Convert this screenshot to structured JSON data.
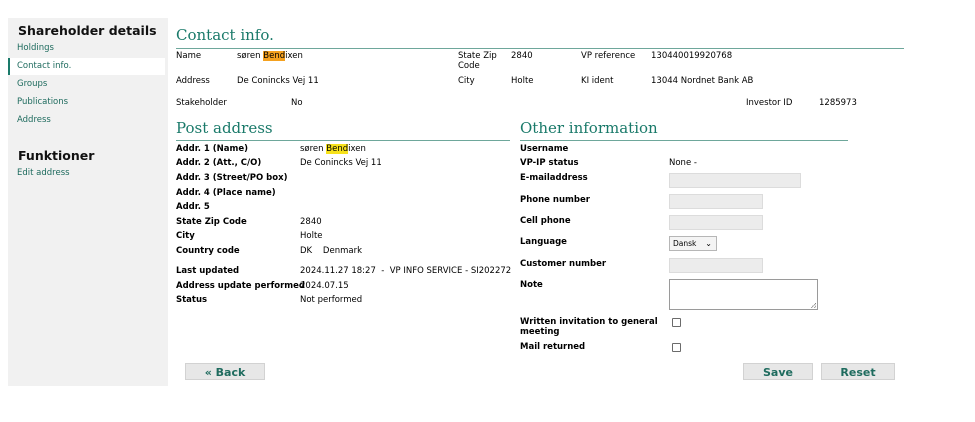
{
  "sidebar": {
    "title": "Shareholder details",
    "items": [
      "Holdings",
      "Contact info.",
      "Groups",
      "Publications",
      "Address"
    ],
    "functions_title": "Funktioner",
    "functions": [
      "Edit address"
    ]
  },
  "contact": {
    "heading": "Contact info.",
    "name_label": "Name",
    "name_prefix": "søren ",
    "name_highlight": "Bend",
    "name_suffix": "ixen",
    "state_zip_label_1": "State Zip",
    "state_zip_label_2": "Code",
    "state_zip_value": "2840",
    "vp_reference_label": "VP reference",
    "vp_reference_value": "130440019920768",
    "address_label": "Address",
    "address_value": "De Conincks Vej 11",
    "city_label": "City",
    "city_value": "Holte",
    "ki_ident_label": "KI ident",
    "ki_ident_value": "13044 Nordnet Bank AB",
    "stakeholder_label": "Stakeholder",
    "stakeholder_value": "No",
    "investor_id_label": "Investor ID",
    "investor_id_value": "1285973"
  },
  "post_address": {
    "heading": "Post address",
    "rows": [
      {
        "label": "Addr. 1 (Name)",
        "value": ""
      },
      {
        "label": "Addr. 2 (Att., C/O)",
        "value": "De Conincks Vej 11"
      },
      {
        "label": "Addr. 3 (Street/PO box)",
        "value": ""
      },
      {
        "label": "Addr. 4 (Place name)",
        "value": ""
      },
      {
        "label": "Addr. 5",
        "value": ""
      },
      {
        "label": "State Zip Code",
        "value": "2840"
      },
      {
        "label": "City",
        "value": "Holte"
      },
      {
        "label": "Country code",
        "value": "DK    Denmark"
      },
      {
        "label": "Last updated",
        "value": "2024.11.27 18:27  -  VP INFO SERVICE - SI202272"
      },
      {
        "label": "Address update performed",
        "value": "2024.07.15"
      },
      {
        "label": "Status",
        "value": "Not performed"
      }
    ],
    "name_prefix": "søren ",
    "name_highlight": "Bend",
    "name_suffix": "ixen"
  },
  "other": {
    "heading": "Other information",
    "username_label": "Username",
    "vpip_label": "VP-IP status",
    "vpip_value": "None -",
    "email_label": "E-mailaddress",
    "phone_label": "Phone number",
    "cell_label": "Cell phone",
    "language_label": "Language",
    "language_value": "Dansk",
    "customer_label": "Customer number",
    "note_label": "Note",
    "invitation_label_1": "Written invitation to general",
    "invitation_label_2": "meeting",
    "mail_returned_label": "Mail returned"
  },
  "buttons": {
    "back": "« Back",
    "save": "Save",
    "reset": "Reset"
  },
  "colors": {
    "accent": "#1a7a6a",
    "highlight_orange": "#f4a11f",
    "highlight_yellow": "#f7e21b"
  }
}
